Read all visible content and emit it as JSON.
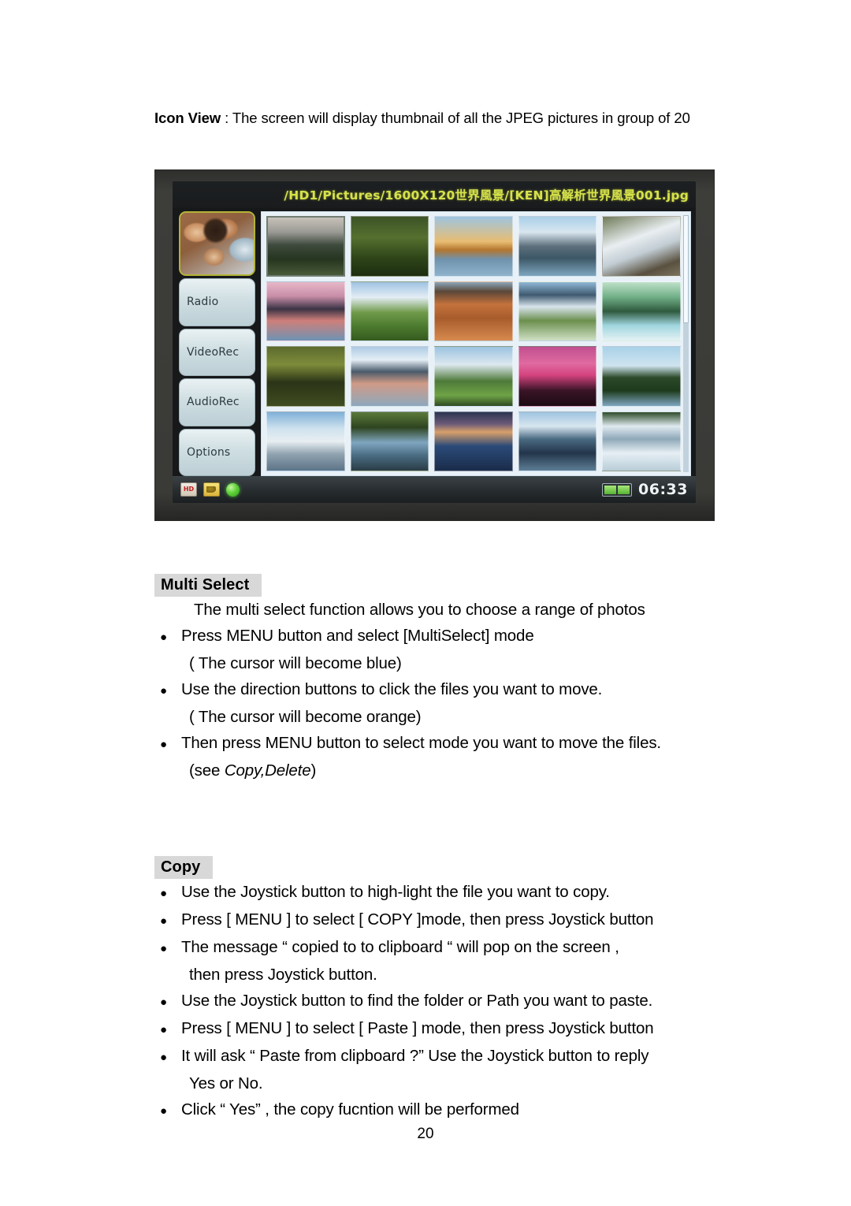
{
  "intro": {
    "lead": "Icon View",
    "rest": " : The screen will display thumbnail of all the JPEG pictures in group of 20"
  },
  "device": {
    "path": "/HD1/Pictures/1600X120世界風景/[KEN]高解析世界風景001.jpg",
    "sidebar": {
      "thumbnail_label": "people-photo-thumbnail",
      "items": [
        {
          "label": "Radio"
        },
        {
          "label": "VideoRec"
        },
        {
          "label": "AudioRec"
        },
        {
          "label": "Options"
        }
      ]
    },
    "grid": {
      "columns": 5,
      "rows": 4,
      "count": 20,
      "selected_index": 0,
      "thumbnails": [
        {
          "name": "misty-mountain-lake"
        },
        {
          "name": "mossy-green-forest"
        },
        {
          "name": "golden-sunset-lake-pier"
        },
        {
          "name": "snow-peak-reflection"
        },
        {
          "name": "rocky-waterfall-rapids"
        },
        {
          "name": "pink-sunrise-river"
        },
        {
          "name": "green-meadow-clouds"
        },
        {
          "name": "red-rock-desert-ridges"
        },
        {
          "name": "alpine-wildflower-lake"
        },
        {
          "name": "emerald-cascade-falls"
        },
        {
          "name": "dense-jungle-canopy"
        },
        {
          "name": "snowy-mountain-lake-dusk"
        },
        {
          "name": "green-hill-glacier"
        },
        {
          "name": "magenta-sunset-cattle"
        },
        {
          "name": "palm-tree-beach"
        },
        {
          "name": "snow-cliff-blue-sky"
        },
        {
          "name": "swamp-forest-reflection"
        },
        {
          "name": "twilight-coastal-inlet"
        },
        {
          "name": "blue-mountain-lake-mist"
        },
        {
          "name": "winter-snow-river"
        }
      ]
    },
    "status_bar": {
      "icons": [
        {
          "name": "hd-drive-icon",
          "text": "HD"
        },
        {
          "name": "folder-icon",
          "text": ""
        },
        {
          "name": "green-status-indicator",
          "text": ""
        }
      ],
      "battery": "battery-icon",
      "time": "06:33"
    }
  },
  "multi_select": {
    "heading": "Multi Select",
    "intro": "The multi select function allows you to choose a range of photos",
    "bullet_char": "●",
    "bullets": [
      {
        "text": "Press MENU button and select [MultiSelect] mode",
        "sub": "( The cursor will become blue)"
      },
      {
        "text": "Use the direction buttons to click the files you want to move.",
        "sub": "( The cursor will become orange)"
      },
      {
        "text": "Then press MENU button to select mode you want to move the files.",
        "sub_prefix": "(see ",
        "sub_italic": "Copy,Delete",
        "sub_suffix": ")"
      }
    ]
  },
  "copy": {
    "heading": "Copy",
    "bullet_char": "●",
    "bullets": [
      {
        "text": "Use the Joystick button to high-light the file you want to copy."
      },
      {
        "text": "Press [ MENU ] to select [ COPY ]mode, then press Joystick button"
      },
      {
        "text": "The message “ copied to to clipboard “ will pop on the screen ,",
        "sub": "then press Joystick button."
      },
      {
        "text": "Use the Joystick button to find the folder or Path you want to paste."
      },
      {
        "text": "Press [ MENU ] to select [ Paste ] mode, then press Joystick button"
      },
      {
        "text": "It will ask “ Paste from clipboard ?”   Use the Joystick button to reply",
        "sub": "Yes or No."
      },
      {
        "text": "Click “ Yes” , the copy fucntion will be performed"
      }
    ]
  },
  "footer": {
    "page_number": "20"
  }
}
